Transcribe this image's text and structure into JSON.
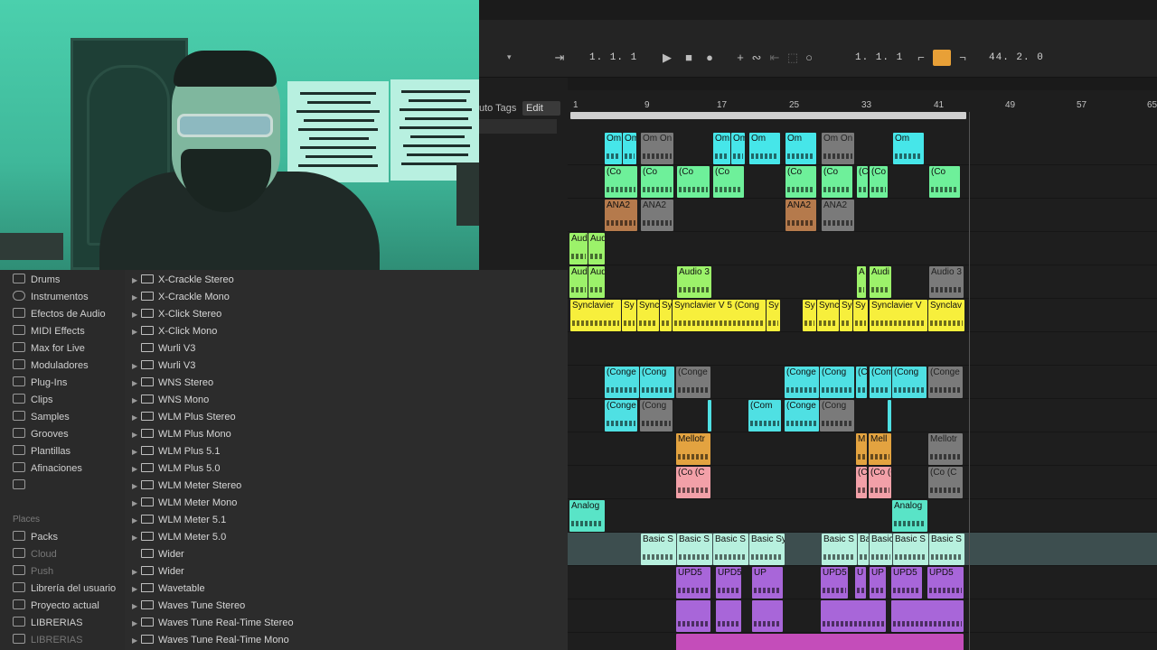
{
  "transport": {
    "arrangement_position": "1.  1.  1",
    "loop_start": "1.  1.  1",
    "loop_length": "44.  2.  0",
    "icons": [
      "follow-icon",
      "play-icon",
      "stop-icon",
      "record-icon",
      "overdub-icon",
      "automation-icon",
      "back-to-arrangement-icon",
      "capture-icon",
      "metronome-icon",
      "punch-in-icon",
      "loop-icon",
      "punch-out-icon"
    ]
  },
  "browser_header": {
    "auto_tags": "uto Tags",
    "edit": "Edit"
  },
  "sidebar": {
    "categories": [
      "Drums",
      "Instrumentos",
      "Efectos de Audio",
      "MIDI Effects",
      "Max for Live",
      "Moduladores",
      "Plug-Ins",
      "Clips",
      "Samples",
      "Grooves",
      "Plantillas",
      "Afinaciones"
    ],
    "places_heading": "Places",
    "places": [
      "Packs",
      "Cloud",
      "Push",
      "Librería del usuario",
      "Proyecto actual",
      "LIBRERIAS",
      "LIBRERIAS"
    ]
  },
  "browser": {
    "items": [
      "X-Crackle Stereo",
      "X-Crackle Mono",
      "X-Click Stereo",
      "X-Click Mono",
      "Wurli V3",
      "Wurli V3",
      "WNS Stereo",
      "WNS Mono",
      "WLM Plus Stereo",
      "WLM Plus Mono",
      "WLM Plus 5.1",
      "WLM Plus 5.0",
      "WLM Meter Stereo",
      "WLM Meter Mono",
      "WLM Meter 5.1",
      "WLM Meter 5.0",
      "Wider",
      "Wider",
      "Wavetable",
      "Waves Tune Stereo",
      "Waves Tune Real-Time Stereo",
      "Waves Tune Real-Time Mono"
    ]
  },
  "ruler": {
    "bars": [
      "1",
      "9",
      "17",
      "25",
      "33",
      "41",
      "49",
      "57",
      "65"
    ]
  },
  "clips": {
    "om": "Om",
    "om_on": "Om On",
    "co": "(Co",
    "co_short": "(C",
    "ana2": "ANA2",
    "aud": "Aud",
    "audio3": "Audio 3",
    "a": "A",
    "audi": "Audi",
    "synclavier": "Synclavier",
    "sy": "Sy",
    "sync": "Sync",
    "synclavier_v5": "Synclavier V 5 (Cong",
    "synclavier_v": "Synclavier V",
    "synclav": "Synclav",
    "conge": "(Conge",
    "cong": "(Cong",
    "com": "(Com",
    "mellotr": "Mellotr",
    "m": "M",
    "mell": "Mell",
    "coc": "(Co (C",
    "analog": "Analog",
    "basic_sy": "Basic Sy",
    "basic_s": "Basic S",
    "upd5": "UPD5",
    "up": "UP",
    "u": "U"
  }
}
